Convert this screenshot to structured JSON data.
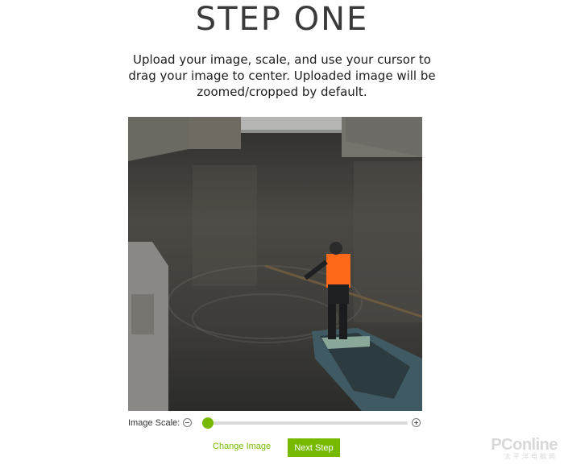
{
  "page": {
    "title": "STEP ONE",
    "description": "Upload your image, scale, and use your cursor to drag your image to center. Uploaded image will be zoomed/cropped by default."
  },
  "image": {
    "alt": "Man in orange vest punting a small boat on a canal"
  },
  "scale": {
    "label": "Image Scale:",
    "value_fraction": 0.0,
    "decrease_icon": "minus-circle-icon",
    "increase_icon": "plus-circle-icon"
  },
  "actions": {
    "change_image": "Change Image",
    "next_step": "Next Step"
  },
  "watermark": {
    "brand": "PConline",
    "subtitle": "太平洋电脑网"
  },
  "colors": {
    "accent": "#76b900",
    "title": "#3a3a3a"
  }
}
